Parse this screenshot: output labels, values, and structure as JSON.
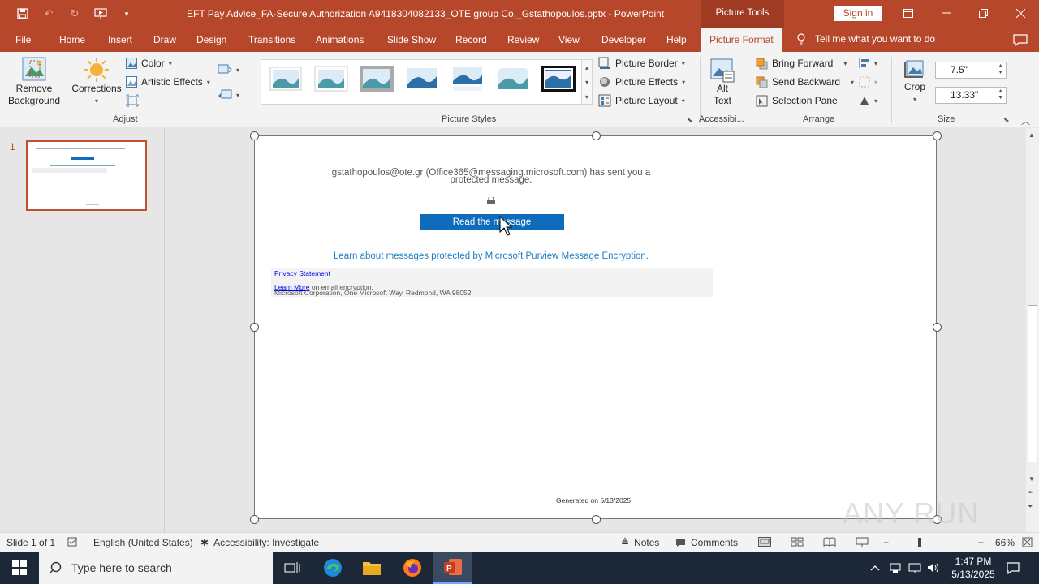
{
  "titlebar": {
    "document_title": "EFT Pay Advice_FA-Secure Authorization A9418304082133_OTE group Co._Gstathopoulos.pptx  -  PowerPoint",
    "picture_tools": "Picture Tools",
    "sign_in": "Sign in"
  },
  "tabs": [
    "File",
    "Home",
    "Insert",
    "Draw",
    "Design",
    "Transitions",
    "Animations",
    "Slide Show",
    "Record",
    "Review",
    "View",
    "Developer",
    "Help",
    "Picture Format"
  ],
  "tell_me": "Tell me what you want to do",
  "ribbon": {
    "remove_background_1": "Remove",
    "remove_background_2": "Background",
    "corrections": "Corrections",
    "color": "Color",
    "artistic_effects": "Artistic Effects",
    "adjust_label": "Adjust",
    "picture_styles_label": "Picture Styles",
    "picture_border": "Picture Border",
    "picture_effects": "Picture Effects",
    "picture_layout": "Picture Layout",
    "alt_text_1": "Alt",
    "alt_text_2": "Text",
    "accessibility_label": "Accessibi...",
    "bring_forward": "Bring Forward",
    "send_backward": "Send Backward",
    "selection_pane": "Selection Pane",
    "arrange_label": "Arrange",
    "crop": "Crop",
    "height_value": "7.5\"",
    "width_value": "13.33\"",
    "size_label": "Size"
  },
  "thumbnail": {
    "number": "1"
  },
  "slide": {
    "sender_line1": "gstathopoulos@ote.gr (Office365@messaging.microsoft.com) has sent you a",
    "sender_line2": "protected message.",
    "read_button": "Read the message",
    "learn_about": "Learn about messages protected by Microsoft Purview Message Encryption.",
    "privacy": "Privacy Statement",
    "learn_more": "Learn More",
    "learn_more_rest": " on email encryption.",
    "address": "Microsoft Corporation, One Microsoft Way, Redmond, WA 98052",
    "generated": "Generated on 5/13/2025"
  },
  "status": {
    "slide_of": "Slide 1 of 1",
    "language": "English (United States)",
    "accessibility": "Accessibility: Investigate",
    "notes": "Notes",
    "comments": "Comments",
    "zoom": "66%"
  },
  "taskbar": {
    "search_placeholder": "Type here to search",
    "time": "1:47 PM",
    "date": "5/13/2025"
  },
  "watermark": "ANY RUN",
  "colors": {
    "accent": "#b7472a",
    "button_blue": "#0f6cbd",
    "link_blue": "#0000ee"
  }
}
